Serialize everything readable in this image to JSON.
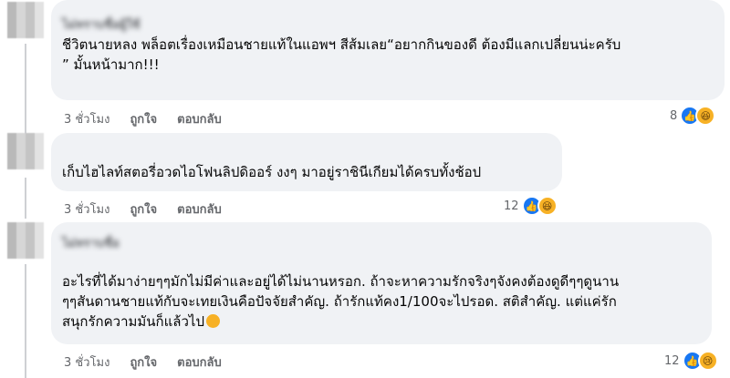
{
  "comments": [
    {
      "author": "ไม่ทราบชื่อผู้ใช้",
      "text": "ชีวิตนายหลง พล็อตเรื่องเหมือนชายแท้ในแอพฯ สีส้มเลย“อยากกินของดี ต้องมีแลกเปลี่ยนน่ะครับ\n” มั้นหน้ามาก!!!",
      "time": "3 ชั่วโมง",
      "like_label": "ถูกใจ",
      "reply_label": "ตอบกลับ",
      "reaction_count": "8",
      "reactions": [
        "like-icon",
        "laugh-icon"
      ]
    },
    {
      "author": "",
      "text": "เก็บไฮไลท์สตอรี่อวดไอโฟนลิปดิออร์ งงๆ มาอยู่ราชินีเกียมได้ครบทั้งช้อป",
      "time": "3 ชั่วโมง",
      "like_label": "ถูกใจ",
      "reply_label": "ตอบกลับ",
      "reaction_count": "12",
      "reactions": [
        "like-icon",
        "laugh-icon"
      ]
    },
    {
      "author": "ไม่ทราบชื่อ",
      "text": "อะไรที่ได้มาง่ายๆๆมักไม่มีค่าและอยู่ได้ไม่นานหรอก. ถ้าจะหาความรักจริงๆจังคงต้องดูดีๆๆดูนาน\nๆๆสันดานชายแท้กับจะเทยเงินคือปัจจัยสำคัญ. ถ้ารักแท้คง1/100จะไปรอด. สติสำคัญ. แต่แค่รัก\nสนุกรักความมันก็แล้วไป",
      "time": "3 ชั่วโมง",
      "like_label": "ถูกใจ",
      "reply_label": "ตอบกลับ",
      "reaction_count": "12",
      "reactions": [
        "like-icon",
        "sad-icon"
      ]
    }
  ]
}
